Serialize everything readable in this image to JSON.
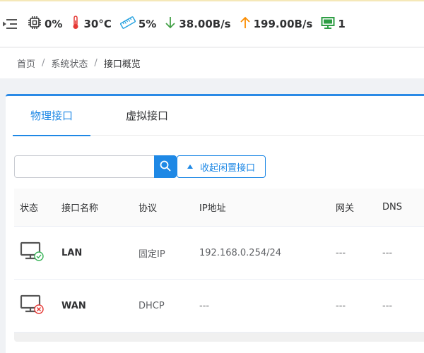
{
  "topbar": {
    "cpu": "0%",
    "temperature": "30°C",
    "memory": "5%",
    "download": "38.00B/s",
    "upload": "199.00B/s",
    "devices": "1"
  },
  "breadcrumb": {
    "home": "首页",
    "separator": "/",
    "section": "系统状态",
    "current": "接口概览"
  },
  "tabs": [
    {
      "label": "物理接口",
      "active": true
    },
    {
      "label": "虚拟接口",
      "active": false
    }
  ],
  "search": {
    "value": "",
    "placeholder": ""
  },
  "collapse_button": "收起闲置接口",
  "table": {
    "headers": [
      "状态",
      "接口名称",
      "协议",
      "IP地址",
      "网关",
      "DNS"
    ],
    "rows": [
      {
        "status": "connected",
        "name": "LAN",
        "protocol": "固定IP",
        "ip": "192.168.0.254/24",
        "gateway": "---",
        "dns": "---"
      },
      {
        "status": "disconnected",
        "name": "WAN",
        "protocol": "DHCP",
        "ip": "---",
        "gateway": "---",
        "dns": "---"
      }
    ]
  },
  "colors": {
    "accent": "#1e88e5",
    "temperature": "#e53935",
    "download": "#43a047",
    "upload": "#fb8c00",
    "online": "#2e9e44",
    "ok_badge": "#3bb55a",
    "error_badge": "#e53935"
  },
  "icons": [
    "menu-fold-icon",
    "cpu-icon",
    "thermometer-icon",
    "memory-icon",
    "arrow-down-icon",
    "arrow-up-icon",
    "monitor-icon",
    "search-icon",
    "caret-up-icon",
    "port-connected-icon",
    "port-disconnected-icon"
  ]
}
